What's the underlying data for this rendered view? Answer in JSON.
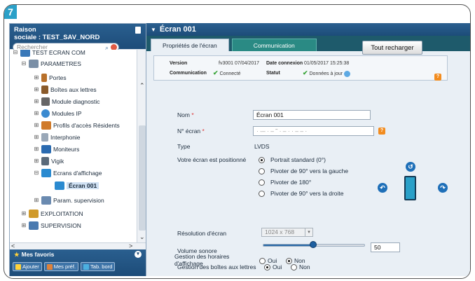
{
  "badge": "7",
  "sidebar": {
    "title_line1": "Raison",
    "title_line2": "sociale : TEST_SAV_NORD",
    "search_placeholder": "Rechercher",
    "tree": [
      {
        "label": "TEST ECRAN COM",
        "icon": "building-icon",
        "color": "#3a78b8"
      },
      {
        "label": "PARAMETRES",
        "icon": "wrench-icon",
        "color": "#7a8fa6"
      },
      {
        "label": "Portes",
        "icon": "door-icon",
        "color": "#b8702a"
      },
      {
        "label": "Boîtes aux lettres",
        "icon": "mailbox-icon",
        "color": "#8a5a2a"
      },
      {
        "label": "Module diagnostic",
        "icon": "tools-icon",
        "color": "#666666"
      },
      {
        "label": "Modules IP",
        "icon": "globe-icon",
        "color": "#3a8ad0"
      },
      {
        "label": "Profils d'accès Résidents",
        "icon": "profile-icon",
        "color": "#d07a2a"
      },
      {
        "label": "Interphonie",
        "icon": "phone-icon",
        "color": "#9aa8b8"
      },
      {
        "label": "Moniteurs",
        "icon": "monitor-icon",
        "color": "#2a6ab0"
      },
      {
        "label": "Vigik",
        "icon": "vigik-icon",
        "color": "#5a6a7a"
      },
      {
        "label": "Ecrans d'affichage",
        "icon": "screen-icon",
        "color": "#2a8ad0"
      },
      {
        "label": "Écran 001",
        "icon": "screen-icon",
        "color": "#2a8ad0"
      },
      {
        "label": "Param. supervision",
        "icon": "supervision-icon",
        "color": "#6a8ab0"
      },
      {
        "label": "EXPLOITATION",
        "icon": "operation-icon",
        "color": "#d09a2a"
      },
      {
        "label": "SUPERVISION",
        "icon": "supervision-icon",
        "color": "#4a7ab0"
      }
    ],
    "favorites": {
      "title": "Mes favoris",
      "buttons": [
        "Ajouter",
        "Mes préf.",
        "Tab. bord"
      ]
    }
  },
  "main": {
    "title": "Écran 001",
    "tabs": [
      "Propriétés de l'écran",
      "Communication"
    ],
    "info": {
      "version_label": "Version",
      "version_value": "fv3001 07/04/2017",
      "date_label": "Date connexion",
      "date_value": "01/05/2017 15:25:38",
      "comm_label": "Communication",
      "comm_value": "Connecté",
      "status_label": "Statut",
      "status_value": "Données à jour",
      "reload_button": "Tout recharger"
    },
    "form": {
      "nom_label": "Nom",
      "nom_value": "Écran 001",
      "num_label": "N° écran",
      "num_value": "· ‐– · – ˜ · – · · – – ·",
      "type_label": "Type",
      "type_value": "LVDS",
      "position_label": "Votre écran est positionné",
      "position_options": [
        "Portrait standard (0°)",
        "Pivoter de 90° vers la gauche",
        "Pivoter de 180°",
        "Pivoter de 90° vers la droite"
      ],
      "resolution_label": "Résolution d'écran",
      "resolution_value": "1024 x 768",
      "volume_label": "Volume sonore",
      "volume_value": "50",
      "mailbox_label": "Gestion des boîtes aux lettres",
      "hours_label_1": "Gestion des horaires",
      "hours_label_2": "d'affichage",
      "oui": "Oui",
      "non": "Non"
    }
  }
}
